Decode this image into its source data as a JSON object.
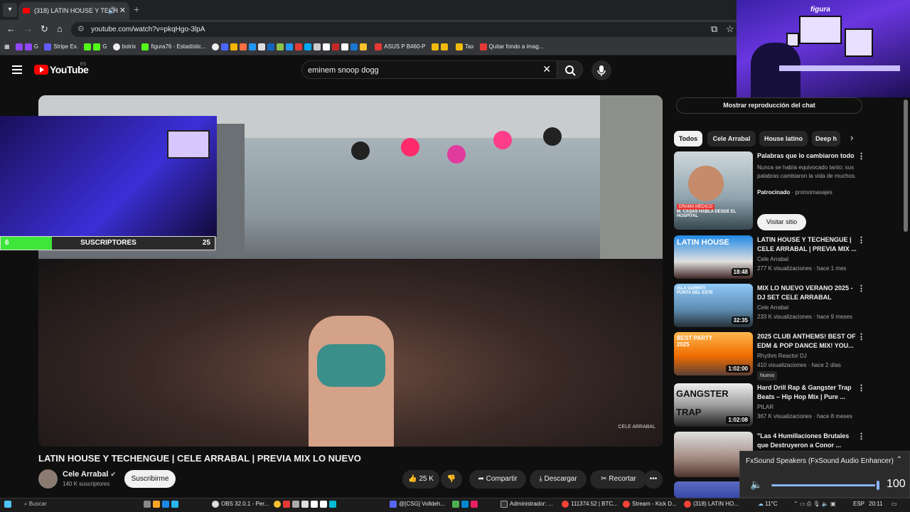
{
  "browser": {
    "tab_title": "(318) LATIN HOUSE Y TECH",
    "new_tab": "+",
    "url": "youtube.com/watch?v=pkqHgo-3lpA",
    "bookmarks": [
      "G",
      "Stripe Ex.",
      "G",
      "botrix",
      "figura76 - Estadístic...",
      "ASUS P B460-P",
      "Tax",
      "Quitar fondo a imag..."
    ]
  },
  "youtube": {
    "logo_text": "YouTube",
    "country_code": "ES",
    "search_value": "eminem snoop dogg"
  },
  "overlay": {
    "subs_current": "6",
    "subs_label": "SUSCRIPTORES",
    "subs_goal": "25",
    "subs_progress": 0.24,
    "webcam_label": "figura",
    "video_watermark": "CELE ARRABAL"
  },
  "video": {
    "title": "LATIN HOUSE Y TECHENGUE | CELE ARRABAL | PREVIA MIX LO NUEVO",
    "channel": "Cele Arrabal",
    "subscribers": "140 K suscriptores",
    "subscribe_label": "Suscribirme",
    "likes": "25 K",
    "share_label": "Compartir",
    "download_label": "Descargar",
    "clip_label": "Recortar"
  },
  "sidebar": {
    "chat_replay_label": "Mostrar reproducción del chat",
    "chips": [
      "Todos",
      "Cele Arrabal",
      "House latino",
      "Deep h"
    ],
    "ad": {
      "title": "Palabras que lo cambiaron todo",
      "desc": "Nunca se había equivocado tanto: sus palabras cambiaron la vida de muchos.",
      "sponsored": "Patrocinado",
      "advertiser": "promomasajes",
      "cta": "Visitar sitio",
      "thumb_tag": "DRAMA MÉDICO",
      "thumb_caption": "M. CASAS HABLA DESDE EL HOSPITAL"
    },
    "items": [
      {
        "title": "LATIN HOUSE Y TECHENGUE | CELE ARRABAL | PREVIA MIX ...",
        "channel": "Cele Arrabal",
        "meta": "277 K visualizaciones · hace 1 mes",
        "duration": "18:48",
        "thumb_text": "LATIN HOUSE"
      },
      {
        "title": "MIX LO NUEVO VERANO 2025 - DJ SET CELE ARRABAL",
        "channel": "Cele Arrabal",
        "meta": "233 K visualizaciones · hace 9 meses",
        "duration": "32:35",
        "thumb_text": "ISLA GORRITI PUNTA DEL ESTE"
      },
      {
        "title": "2025 CLUB ANTHEMS! BEST OF EDM & POP DANCE MIX! YOU...",
        "channel": "Rhythm Reactor DJ",
        "meta": "410 visualizaciones · hace 2 días",
        "duration": "1:02:00",
        "badge": "Nuevo",
        "thumb_text": "BEST PARTY 2025"
      },
      {
        "title": "Hard Drill Rap & Gangster Trap Beats – Hip Hop Mix | Pure ...",
        "channel": "PILAR",
        "meta": "367 K visualizaciones · hace 8 meses",
        "duration": "1:02:08",
        "thumb_text": "GANGSTER TRAP"
      },
      {
        "title": "\"Las 4 Humillaciones Brutales que Destruyeron a Conor ..."
      }
    ]
  },
  "audio_popup": {
    "device": "FxSound Speakers (FxSound Audio Enhancer)",
    "volume": "100",
    "level": 1.0
  },
  "taskbar": {
    "search": "Buscar",
    "apps": [
      "OBS 32.0.1 - Per...",
      "@[CSG] Volldeh...",
      "Administrador: ...",
      "111374.52 | BTC...",
      "Stream - Kick D...",
      "(318) LATIN HO..."
    ],
    "temp": "11°C",
    "lang": "ESP",
    "time": "20:11"
  },
  "colors": {
    "accent_red": "#ff0000",
    "progress_green": "#3ee63a",
    "volume_blue": "#8ab4f8"
  }
}
